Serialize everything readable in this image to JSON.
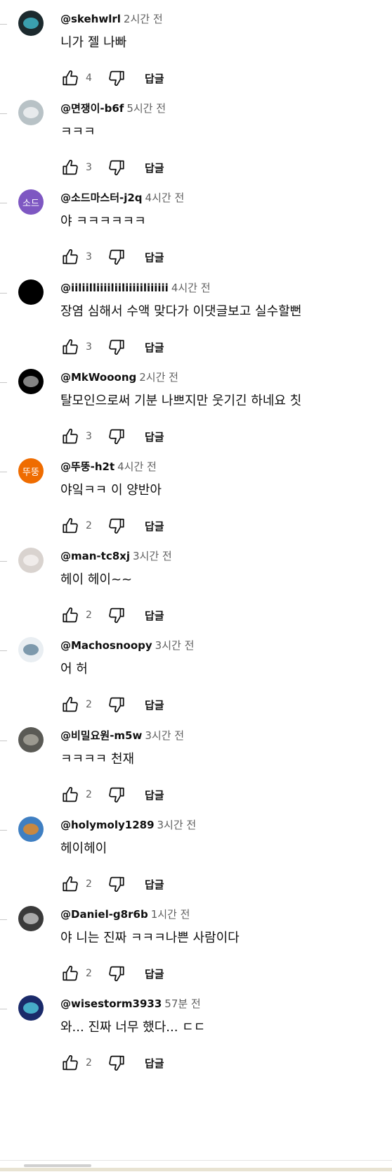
{
  "labels": {
    "reply": "답글"
  },
  "comments": [
    {
      "author": "@skehwlrl",
      "time": "2시간 전",
      "text": "니가 젤 나빠",
      "likes": "4",
      "avatar": {
        "kind": "image",
        "bg": "#1c2a2e",
        "fg": "#3fb4c4"
      }
    },
    {
      "author": "@면쟁이-b6f",
      "time": "5시간 전",
      "text": "ㅋㅋㅋ",
      "likes": "3",
      "avatar": {
        "kind": "image",
        "bg": "#b8c2c6",
        "fg": "#eef1f2"
      }
    },
    {
      "author": "@소드마스터-j2q",
      "time": "4시간 전",
      "text": "야 ㅋㅋㅋㅋㅋㅋ",
      "likes": "3",
      "avatar": {
        "kind": "initials",
        "initials": "소드",
        "bg": "#7e57c2"
      }
    },
    {
      "author": "@iiliilliiiiliiliiiiiliiiiii",
      "time": "4시간 전",
      "text": "장염 심해서 수액 맞다가 이댓글보고 실수할뻔",
      "likes": "3",
      "avatar": {
        "kind": "solid",
        "bg": "#000000"
      }
    },
    {
      "author": "@MkWooong",
      "time": "2시간 전",
      "text": "탈모인으로써 기분 나쁘지만 웃기긴 하네요 칫",
      "likes": "3",
      "avatar": {
        "kind": "image",
        "bg": "#000000",
        "fg": "#9a9a9a"
      }
    },
    {
      "author": "@뚜뚱-h2t",
      "time": "4시간 전",
      "text": "야잌ㅋㅋ 이 양반아",
      "likes": "2",
      "avatar": {
        "kind": "initials",
        "initials": "뚜뚱",
        "bg": "#ef6c00"
      }
    },
    {
      "author": "@man-tc8xj",
      "time": "3시간 전",
      "text": "헤이 헤이~~",
      "likes": "2",
      "avatar": {
        "kind": "image",
        "bg": "#d9d3cf",
        "fg": "#f3f0ee"
      }
    },
    {
      "author": "@Machosnoopy",
      "time": "3시간 전",
      "text": "어 허",
      "likes": "2",
      "avatar": {
        "kind": "image",
        "bg": "#e9eef2",
        "fg": "#6a8aa0"
      }
    },
    {
      "author": "@비밀요원-m5w",
      "time": "3시간 전",
      "text": "ㅋㅋㅋㅋ 천재",
      "likes": "2",
      "avatar": {
        "kind": "image",
        "bg": "#5a5a55",
        "fg": "#a7a49b"
      }
    },
    {
      "author": "@holymoly1289",
      "time": "3시간 전",
      "text": "헤이헤이",
      "likes": "2",
      "avatar": {
        "kind": "image",
        "bg": "#3f7fc2",
        "fg": "#e08a2a"
      }
    },
    {
      "author": "@Daniel-g8r6b",
      "time": "1시간 전",
      "text": "야 니는 진짜 ㅋㅋㅋ나쁜 사람이다",
      "likes": "2",
      "avatar": {
        "kind": "image",
        "bg": "#3a3a3a",
        "fg": "#bdbdbd"
      }
    },
    {
      "author": "@wisestorm3933",
      "time": "57분 전",
      "text": "와... 진짜 너무 했다... ㄷㄷ",
      "likes": "2",
      "avatar": {
        "kind": "image",
        "bg": "#1a2a6a",
        "fg": "#4fc3d8"
      }
    }
  ]
}
